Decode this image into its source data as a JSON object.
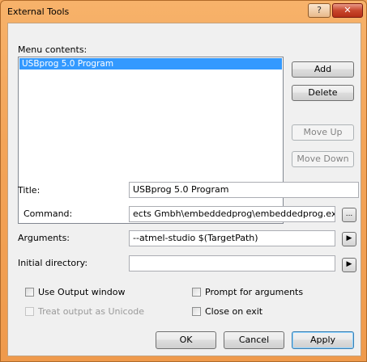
{
  "window": {
    "title": "External Tools",
    "help_glyph": "?",
    "close_glyph": "✕"
  },
  "menu": {
    "label": "Menu contents:",
    "items": [
      "USBprog 5.0 Program"
    ],
    "selected_index": 0
  },
  "side_buttons": {
    "add": "Add",
    "delete": "Delete",
    "move_up": "Move Up",
    "move_down": "Move Down"
  },
  "fields": {
    "title_label": "Title:",
    "title_value": "USBprog 5.0 Program",
    "command_label": "Command:",
    "command_value": "ects Gmbh\\embeddedprog\\embeddedprog.exe",
    "command_browse": "...",
    "arguments_label": "Arguments:",
    "arguments_value": "--atmel-studio $(TargetPath)",
    "arguments_arrow": "▶",
    "initial_dir_label": "Initial directory:",
    "initial_dir_value": "",
    "initial_dir_arrow": "▶"
  },
  "options": {
    "use_output_window": {
      "label": "Use Output window",
      "checked": false,
      "enabled": true
    },
    "treat_unicode": {
      "label": "Treat output as Unicode",
      "checked": false,
      "enabled": false
    },
    "prompt_arguments": {
      "label": "Prompt for arguments",
      "checked": false,
      "enabled": true
    },
    "close_on_exit": {
      "label": "Close on exit",
      "checked": false,
      "enabled": true
    }
  },
  "footer": {
    "ok": "OK",
    "cancel": "Cancel",
    "apply": "Apply"
  }
}
